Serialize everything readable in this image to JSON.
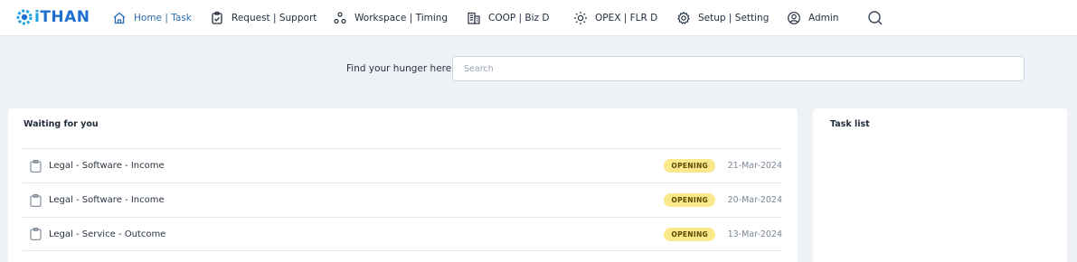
{
  "app": {
    "logo_text_prefix": "i",
    "logo_text_rest": "THAN",
    "logo_icon": "gear-logo-icon",
    "brand_colors": {
      "primary": "#1f6fd0",
      "accent": "#1fa3e0"
    }
  },
  "nav": {
    "items": [
      {
        "label": "Home | Task",
        "icon": "home-icon",
        "active": true
      },
      {
        "label": "Request | Support",
        "icon": "clipboard-check-icon",
        "active": false
      },
      {
        "label": "Workspace | Timing",
        "icon": "nodes-icon",
        "active": false
      },
      {
        "label": "COOP | Biz D",
        "icon": "building-icon",
        "active": false
      },
      {
        "label": "OPEX | FLR D",
        "icon": "sun-icon",
        "active": false
      },
      {
        "label": "Setup | Setting",
        "icon": "gear-icon",
        "active": false
      },
      {
        "label": "Admin",
        "icon": "user-circle-icon",
        "active": false
      }
    ],
    "search_icon": "search-icon"
  },
  "search": {
    "label": "Find your hunger here",
    "placeholder": "Search",
    "value": ""
  },
  "waiting": {
    "title": "Waiting for you",
    "rows": [
      {
        "title": "Legal - Software - Income",
        "status": "OPENING",
        "date": "21-Mar-2024",
        "icon": "clipboard-icon"
      },
      {
        "title": "Legal - Software - Income",
        "status": "OPENING",
        "date": "20-Mar-2024",
        "icon": "clipboard-icon"
      },
      {
        "title": "Legal - Service - Outcome",
        "status": "OPENING",
        "date": "13-Mar-2024",
        "icon": "clipboard-icon"
      }
    ],
    "status_color": "#fbe88a"
  },
  "task_list": {
    "title": "Task list"
  }
}
